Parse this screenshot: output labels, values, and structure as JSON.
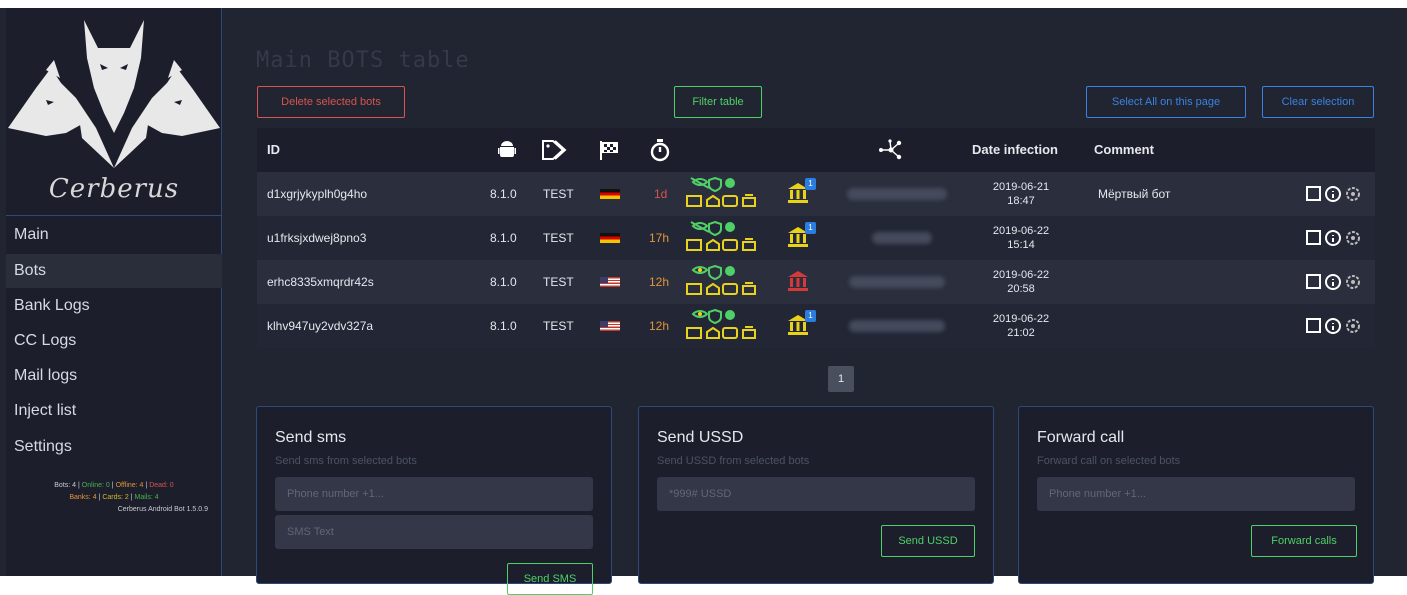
{
  "brand": {
    "name": "Cerberus"
  },
  "sidebar": {
    "items": [
      {
        "label": "Main"
      },
      {
        "label": "Bots"
      },
      {
        "label": "Bank Logs"
      },
      {
        "label": "CC Logs"
      },
      {
        "label": "Mail logs"
      },
      {
        "label": "Inject list"
      },
      {
        "label": "Settings"
      }
    ],
    "active": "Bots",
    "stats": {
      "bots": "Bots: 4",
      "online": "Online: 0",
      "offline": "Offline: 4",
      "dead": "Dead: 0",
      "banks": "Banks: 4",
      "cards": "Cards: 2",
      "mails": "Mails: 4",
      "version": "Cerberus Android Bot 1.5.0.9",
      "sep": "|"
    }
  },
  "page": {
    "title": "Main BOTS table"
  },
  "toolbar": {
    "delete_label": "Delete selected bots",
    "filter_label": "Filter table",
    "select_all_label": "Select All on this page",
    "clear_label": "Clear selection"
  },
  "table": {
    "headers": {
      "id": "ID",
      "android_icon": "android-icon",
      "tag_icon": "tag-icon",
      "flag_icon": "checkered-flag-icon",
      "timer_icon": "stopwatch-icon",
      "network_icon": "network-icon",
      "date": "Date infection",
      "comment": "Comment"
    },
    "rows": [
      {
        "id": "d1xgrjykyplh0g4ho",
        "version": "8.1.0",
        "tag": "TEST",
        "country": "de",
        "time": "1d",
        "date": "2019-06-21",
        "clock": "18:47",
        "comment": "Мёртвый бот",
        "bank_badge": "1",
        "bank_color": "#e8d31a"
      },
      {
        "id": "u1frksjxdwej8pno3",
        "version": "8.1.0",
        "tag": "TEST",
        "country": "de",
        "time": "17h",
        "date": "2019-06-22",
        "clock": "15:14",
        "comment": "",
        "bank_badge": "1",
        "bank_color": "#e8d31a"
      },
      {
        "id": "erhc8335xmqrdr42s",
        "version": "8.1.0",
        "tag": "TEST",
        "country": "us",
        "time": "12h",
        "date": "2019-06-22",
        "clock": "20:58",
        "comment": "",
        "bank_badge": "",
        "bank_color": "#d43a3a"
      },
      {
        "id": "klhv947uy2vdv327a",
        "version": "8.1.0",
        "tag": "TEST",
        "country": "us",
        "time": "12h",
        "date": "2019-06-22",
        "clock": "21:02",
        "comment": "",
        "bank_badge": "1",
        "bank_color": "#e8d31a"
      }
    ]
  },
  "pagination": {
    "current": "1"
  },
  "cards": {
    "sms": {
      "title": "Send sms",
      "subtitle": "Send sms from selected bots",
      "phone_placeholder": "Phone number +1...",
      "text_placeholder": "SMS Text",
      "button": "Send SMS"
    },
    "ussd": {
      "title": "Send USSD",
      "subtitle": "Send USSD from selected bots",
      "placeholder": "*999# USSD",
      "button": "Send USSD"
    },
    "forward": {
      "title": "Forward call",
      "subtitle": "Forward call on selected bots",
      "placeholder": "Phone number +1...",
      "button": "Forward calls"
    }
  },
  "colors": {
    "background": "#212431",
    "sidebar": "#1c1f2b",
    "accent_blue": "#3b82e0",
    "danger": "#d9534f",
    "success": "#4fd067"
  }
}
